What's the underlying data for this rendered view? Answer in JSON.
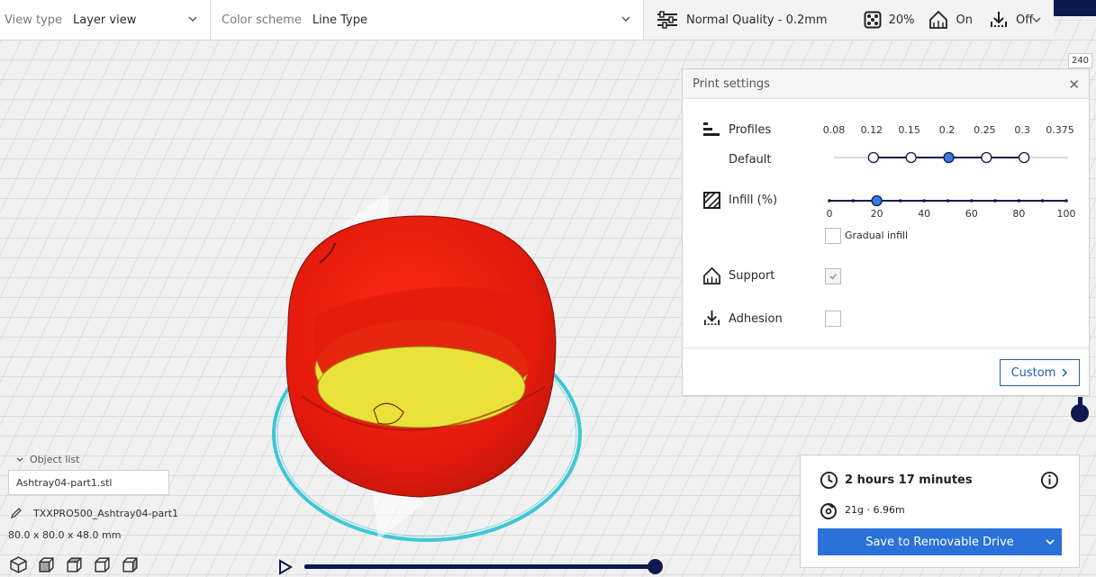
{
  "toolbar": {
    "view_type_label": "View type",
    "view_type_value": "Layer view",
    "color_scheme_label": "Color scheme",
    "color_scheme_value": "Line Type",
    "quality": "Normal Quality - 0.2mm",
    "infill": "20%",
    "support": "On",
    "adhesion": "Off"
  },
  "layer_max_badge": "240",
  "print_settings": {
    "title": "Print settings",
    "profiles_label": "Profiles",
    "default_label": "Default",
    "profile_ticks": [
      "0.08",
      "0.12",
      "0.15",
      "0.2",
      "0.25",
      "0.3",
      "0.375"
    ],
    "selected_profile": "0.2",
    "infill_label": "Infill (%)",
    "infill_ticks": [
      "0",
      "20",
      "40",
      "60",
      "80",
      "100"
    ],
    "infill_value": 20,
    "gradual_infill_label": "Gradual infill",
    "support_label": "Support",
    "support_checked": true,
    "adhesion_label": "Adhesion",
    "adhesion_checked": false,
    "custom_button": "Custom"
  },
  "job": {
    "time": "2 hours 17 minutes",
    "material": "21g · 6.96m",
    "save_button": "Save to Removable Drive"
  },
  "object_list": {
    "header": "Object list",
    "file": "Ashtray04-part1.stl",
    "name": "TXXPRO500_Ashtray04-part1",
    "dimensions": "80.0 x 80.0 x 48.0 mm"
  },
  "colors": {
    "accent": "#2a71d8",
    "dark_navy": "#0e1a4f",
    "model_red": "#e51c0e",
    "model_yellow": "#e8e23a",
    "support_cyan": "#3fc6d6"
  }
}
